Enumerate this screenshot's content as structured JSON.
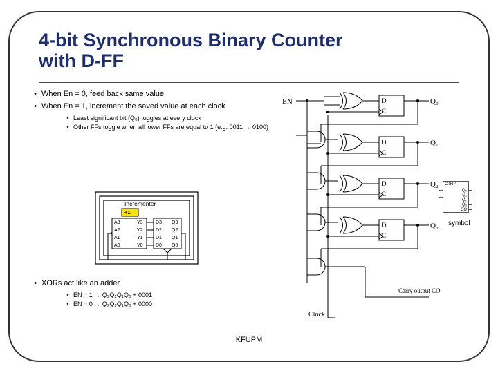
{
  "title": "4-bit Synchronous Binary Counter with D-FF",
  "bullets": {
    "b1": "When En = 0, feed back same value",
    "b2": "When En = 1, increment the saved value at each clock",
    "b2a": "Least significant bit (Q₀) toggles at every clock",
    "b2b": "Other FFs toggle when all lower FFs are equal to 1 (e.g. 0011 → 0100)",
    "b3": "XORs act like an adder",
    "b3a": "EN = 1 → Q₃Q₂Q₁Q₀ + 0001",
    "b3b": "EN = 0 → Q₃Q₂Q₁Q₀ + 0000"
  },
  "footer": "KFUPM",
  "symbol_label": "symbol",
  "circuit_labels": {
    "EN": "EN",
    "D": "D",
    "C": "C",
    "Q0": "Q₀",
    "Q1": "Q₁",
    "Q2": "Q₂",
    "Q3": "Q₃",
    "Clock": "Clock",
    "Carry": "Carry output CO"
  },
  "incrementer": {
    "title": "Incrementer",
    "plus1": "+1",
    "rows": [
      {
        "A": "A3",
        "Y": "Y3",
        "D": "D3",
        "Q": "Q3"
      },
      {
        "A": "A2",
        "Y": "Y2",
        "D": "D2",
        "Q": "Q2"
      },
      {
        "A": "A1",
        "Y": "Y1",
        "D": "D1",
        "Q": "Q1"
      },
      {
        "A": "A0",
        "Y": "Y0",
        "D": "D0",
        "Q": "Q0"
      }
    ]
  },
  "symbol_box": {
    "title": "CTR 4",
    "q": [
      "Q₀",
      "Q₁",
      "Q₂",
      "Q₃"
    ],
    "co": "CO"
  }
}
